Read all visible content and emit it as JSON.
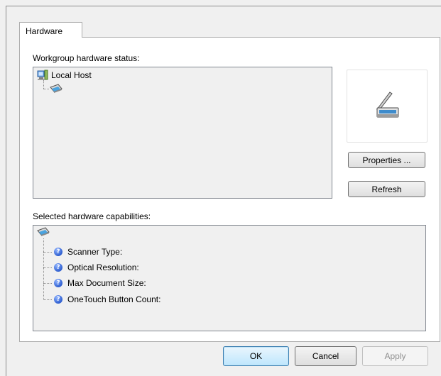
{
  "tab": {
    "label": "Hardware"
  },
  "status_section": {
    "label": "Workgroup hardware status:",
    "tree": {
      "root_label": "Local Host"
    }
  },
  "buttons": {
    "properties": "Properties ...",
    "refresh": "Refresh",
    "ok": "OK",
    "cancel": "Cancel",
    "apply": "Apply"
  },
  "capabilities_section": {
    "label": "Selected hardware capabilities:",
    "items": [
      "Scanner Type:",
      "Optical Resolution:",
      "Max Document Size:",
      "OneTouch Button Count:"
    ]
  },
  "colors": {
    "panel": "#ffffff",
    "window": "#f0f0f0",
    "default_button_border": "#3c7fb1"
  }
}
